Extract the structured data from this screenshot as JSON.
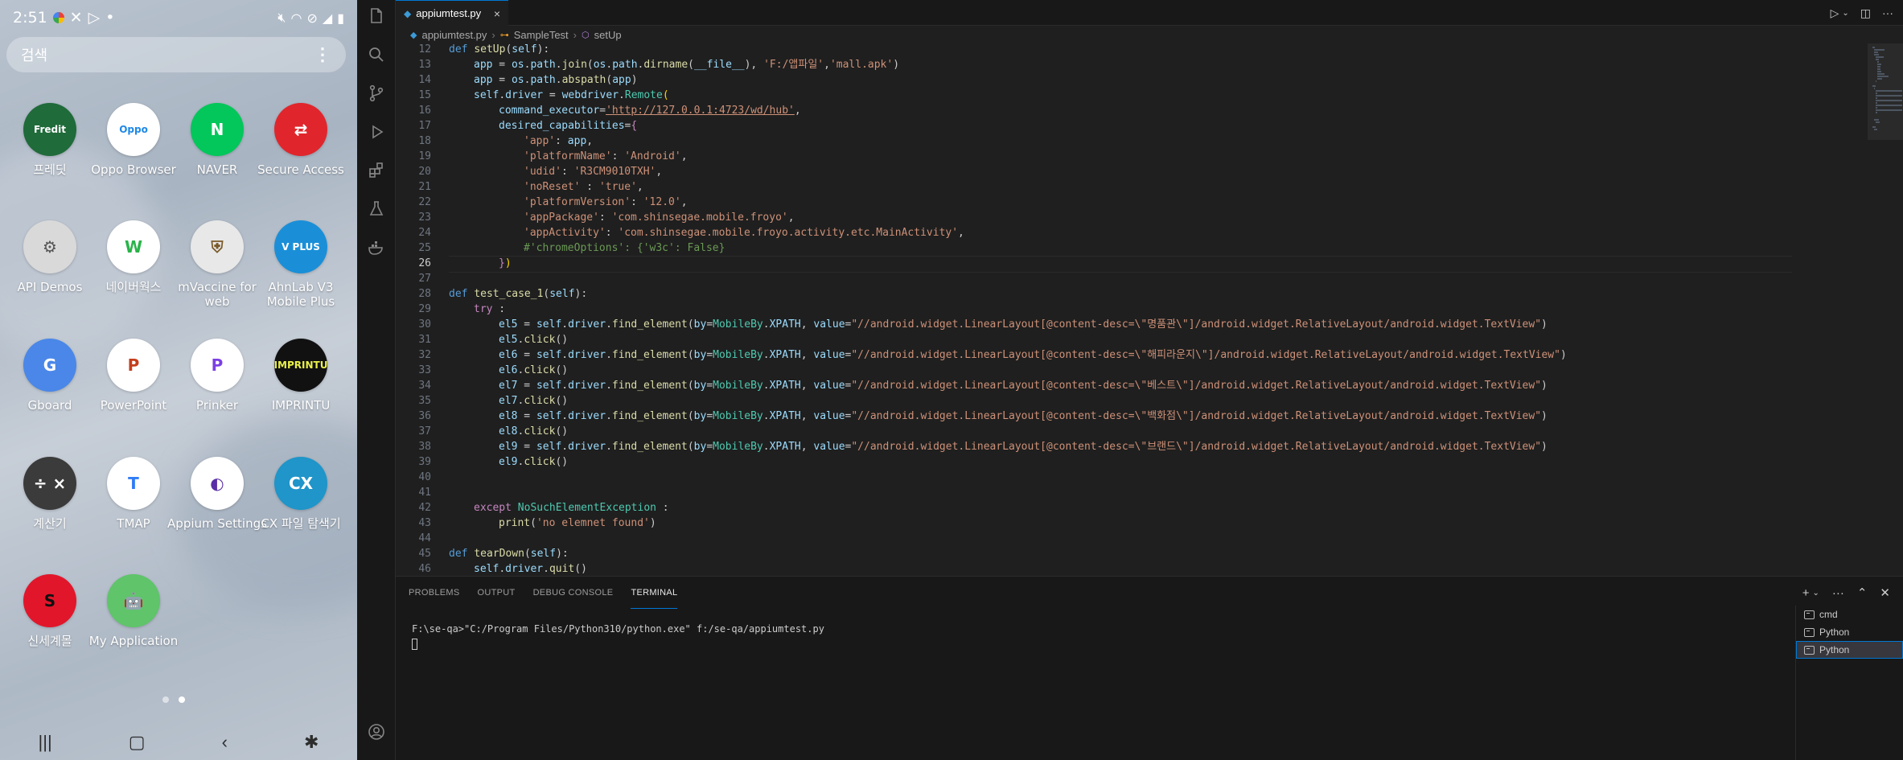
{
  "phone": {
    "status": {
      "time": "2:51",
      "left_indicator": "•"
    },
    "search": {
      "placeholder": "검색",
      "more_icon": "⋮"
    },
    "apps": [
      {
        "label": "프레딧",
        "glyph": "Fredit",
        "bg": "#1f6b3a",
        "fg": "#ffffff",
        "icon": "fredit-app-icon"
      },
      {
        "label": "Oppo Browser",
        "glyph": "Oppo",
        "bg": "#ffffff",
        "fg": "#1e88e5",
        "icon": "oppo-browser-app-icon"
      },
      {
        "label": "NAVER",
        "glyph": "N",
        "bg": "#03c75a",
        "fg": "#ffffff",
        "icon": "naver-app-icon"
      },
      {
        "label": "Secure Access",
        "glyph": "⇄",
        "bg": "#e0262c",
        "fg": "#ffffff",
        "icon": "secure-access-app-icon"
      },
      {
        "label": "API Demos",
        "glyph": "⚙",
        "bg": "#d9d9d9",
        "fg": "#555555",
        "icon": "api-demos-app-icon"
      },
      {
        "label": "네이버웍스",
        "glyph": "W",
        "bg": "#ffffff",
        "fg": "#2ab34a",
        "icon": "naver-works-app-icon"
      },
      {
        "label": "mVaccine for web",
        "glyph": "⛨",
        "bg": "#e8e8e8",
        "fg": "#7a5a2a",
        "icon": "mvaccine-app-icon"
      },
      {
        "label": "AhnLab V3 Mobile Plus",
        "glyph": "V PLUS",
        "bg": "#1a8fd8",
        "fg": "#ffffff",
        "icon": "ahnlab-v3-app-icon"
      },
      {
        "label": "Gboard",
        "glyph": "G",
        "bg": "#4a87e8",
        "fg": "#ffffff",
        "icon": "gboard-app-icon"
      },
      {
        "label": "PowerPoint",
        "glyph": "P",
        "bg": "#ffffff",
        "fg": "#c43e1c",
        "icon": "powerpoint-app-icon"
      },
      {
        "label": "Prinker",
        "glyph": "P",
        "bg": "#ffffff",
        "fg": "#7b3fe4",
        "icon": "prinker-app-icon"
      },
      {
        "label": "IMPRINTU",
        "glyph": "IMPRINTU",
        "bg": "#111111",
        "fg": "#e9f04a",
        "icon": "imprintu-app-icon"
      },
      {
        "label": "계산기",
        "glyph": "÷ ×",
        "bg": "#3b3b3b",
        "fg": "#ffffff",
        "icon": "calculator-app-icon"
      },
      {
        "label": "TMAP",
        "glyph": "T",
        "bg": "#ffffff",
        "fg": "#2f7cf6",
        "icon": "tmap-app-icon"
      },
      {
        "label": "Appium Settings",
        "glyph": "◐",
        "bg": "#ffffff",
        "fg": "#5a2ea6",
        "icon": "appium-settings-app-icon"
      },
      {
        "label": "CX 파일 탐색기",
        "glyph": "CX",
        "bg": "#1f95c9",
        "fg": "#ffffff",
        "icon": "cx-file-explorer-app-icon"
      },
      {
        "label": "신세계몰",
        "glyph": "S",
        "bg": "#e1162b",
        "fg": "#111111",
        "icon": "shinsegae-mall-app-icon"
      },
      {
        "label": "My Application",
        "glyph": "🤖",
        "bg": "#5fc46a",
        "fg": "#ffffff",
        "icon": "my-application-app-icon"
      }
    ],
    "nav": {
      "recents": "|||",
      "home": "▢",
      "back": "‹",
      "accessibility": "✱"
    }
  },
  "vscode": {
    "tab": {
      "filename": "appiumtest.py",
      "close": "×"
    },
    "breadcrumb": [
      "appiumtest.py",
      "SampleTest",
      "setUp"
    ],
    "code": [
      {
        "n": "12",
        "h": "<span class=\"kw\">def</span> <span class=\"fn\">setUp</span>(<span class=\"var\">self</span>):",
        "indent": 1
      },
      {
        "n": "13",
        "h": "<span class=\"var\">app</span> = <span class=\"var\">os</span>.<span class=\"var\">path</span>.<span class=\"fn\">join</span>(<span class=\"var\">os</span>.<span class=\"var\">path</span>.<span class=\"fn\">dirname</span>(<span class=\"var\">__file__</span>), <span class=\"str\">'F:/앱파일'</span>,<span class=\"str\">'mall.apk'</span>)",
        "indent": 2
      },
      {
        "n": "14",
        "h": "<span class=\"var\">app</span> = <span class=\"var\">os</span>.<span class=\"var\">path</span>.<span class=\"fn\">abspath</span>(<span class=\"var\">app</span>)",
        "indent": 2
      },
      {
        "n": "15",
        "h": "<span class=\"var\">self</span>.<span class=\"var\">driver</span> = <span class=\"var\">webdriver</span>.<span class=\"cls\">Remote</span><span class=\"brk\">(</span>",
        "indent": 2
      },
      {
        "n": "16",
        "h": "<span class=\"var\">command_executor</span>=<span class=\"url\">'http://127.0.0.1:4723/wd/hub'</span>,",
        "indent": 3
      },
      {
        "n": "17",
        "h": "<span class=\"var\">desired_capabilities</span>=<span class=\"kw2\">{</span>",
        "indent": 3
      },
      {
        "n": "18",
        "h": "<span class=\"str\">'app'</span>: <span class=\"var\">app</span>,",
        "indent": 4
      },
      {
        "n": "19",
        "h": "<span class=\"str\">'platformName'</span>: <span class=\"str\">'Android'</span>,",
        "indent": 4
      },
      {
        "n": "20",
        "h": "<span class=\"str\">'udid'</span>: <span class=\"str\">'R3CM9010TXH'</span>,",
        "indent": 4
      },
      {
        "n": "21",
        "h": "<span class=\"str\">'noReset'</span> : <span class=\"str\">'true'</span>,",
        "indent": 4
      },
      {
        "n": "22",
        "h": "<span class=\"str\">'platformVersion'</span>: <span class=\"str\">'12.0'</span>,",
        "indent": 4
      },
      {
        "n": "23",
        "h": "<span class=\"str\">'appPackage'</span>: <span class=\"str\">'com.shinsegae.mobile.froyo'</span>,",
        "indent": 4
      },
      {
        "n": "24",
        "h": "<span class=\"str\">'appActivity'</span>: <span class=\"str\">'com.shinsegae.mobile.froyo.activity.etc.MainActivity'</span>,",
        "indent": 4
      },
      {
        "n": "25",
        "h": "<span class=\"cmt\">#'chromeOptions': {'w3c': False}</span>",
        "indent": 4
      },
      {
        "n": "26",
        "h": "<span class=\"kw2\">}</span><span class=\"brk\">)</span>",
        "indent": 3,
        "current": true
      },
      {
        "n": "27",
        "h": "",
        "indent": 0
      },
      {
        "n": "28",
        "h": "<span class=\"kw\">def</span> <span class=\"fn\">test_case_1</span>(<span class=\"var\">self</span>):",
        "indent": 1
      },
      {
        "n": "29",
        "h": "<span class=\"kw2\">try</span> :",
        "indent": 2
      },
      {
        "n": "30",
        "h": "<span class=\"var\">el5</span> = <span class=\"var\">self</span>.<span class=\"var\">driver</span>.<span class=\"fn\">find_element</span>(<span class=\"var\">by</span>=<span class=\"cls\">MobileBy</span>.<span class=\"var\">XPATH</span>, <span class=\"var\">value</span>=<span class=\"str\">\"//android.widget.LinearLayout[@content-desc=\\\"명품관\\\"]/android.widget.RelativeLayout/android.widget.TextView\"</span>)",
        "indent": 3
      },
      {
        "n": "31",
        "h": "<span class=\"var\">el5</span>.<span class=\"fn\">click</span>()",
        "indent": 3
      },
      {
        "n": "32",
        "h": "<span class=\"var\">el6</span> = <span class=\"var\">self</span>.<span class=\"var\">driver</span>.<span class=\"fn\">find_element</span>(<span class=\"var\">by</span>=<span class=\"cls\">MobileBy</span>.<span class=\"var\">XPATH</span>, <span class=\"var\">value</span>=<span class=\"str\">\"//android.widget.LinearLayout[@content-desc=\\\"해피라운지\\\"]/android.widget.RelativeLayout/android.widget.TextView\"</span>)",
        "indent": 3
      },
      {
        "n": "33",
        "h": "<span class=\"var\">el6</span>.<span class=\"fn\">click</span>()",
        "indent": 3
      },
      {
        "n": "34",
        "h": "<span class=\"var\">el7</span> = <span class=\"var\">self</span>.<span class=\"var\">driver</span>.<span class=\"fn\">find_element</span>(<span class=\"var\">by</span>=<span class=\"cls\">MobileBy</span>.<span class=\"var\">XPATH</span>, <span class=\"var\">value</span>=<span class=\"str\">\"//android.widget.LinearLayout[@content-desc=\\\"베스트\\\"]/android.widget.RelativeLayout/android.widget.TextView\"</span>)",
        "indent": 3
      },
      {
        "n": "35",
        "h": "<span class=\"var\">el7</span>.<span class=\"fn\">click</span>()",
        "indent": 3
      },
      {
        "n": "36",
        "h": "<span class=\"var\">el8</span> = <span class=\"var\">self</span>.<span class=\"var\">driver</span>.<span class=\"fn\">find_element</span>(<span class=\"var\">by</span>=<span class=\"cls\">MobileBy</span>.<span class=\"var\">XPATH</span>, <span class=\"var\">value</span>=<span class=\"str\">\"//android.widget.LinearLayout[@content-desc=\\\"백화점\\\"]/android.widget.RelativeLayout/android.widget.TextView\"</span>)",
        "indent": 3
      },
      {
        "n": "37",
        "h": "<span class=\"var\">el8</span>.<span class=\"fn\">click</span>()",
        "indent": 3
      },
      {
        "n": "38",
        "h": "<span class=\"var\">el9</span> = <span class=\"var\">self</span>.<span class=\"var\">driver</span>.<span class=\"fn\">find_element</span>(<span class=\"var\">by</span>=<span class=\"cls\">MobileBy</span>.<span class=\"var\">XPATH</span>, <span class=\"var\">value</span>=<span class=\"str\">\"//android.widget.LinearLayout[@content-desc=\\\"브랜드\\\"]/android.widget.RelativeLayout/android.widget.TextView\"</span>)",
        "indent": 3
      },
      {
        "n": "39",
        "h": "<span class=\"var\">el9</span>.<span class=\"fn\">click</span>()",
        "indent": 3
      },
      {
        "n": "40",
        "h": "",
        "indent": 0
      },
      {
        "n": "41",
        "h": "",
        "indent": 0
      },
      {
        "n": "42",
        "h": "<span class=\"kw2\">except</span> <span class=\"cls\">NoSuchElementException</span> :",
        "indent": 2
      },
      {
        "n": "43",
        "h": "<span class=\"fn\">print</span>(<span class=\"str\">'no elemnet found'</span>)",
        "indent": 3
      },
      {
        "n": "44",
        "h": "",
        "indent": 0
      },
      {
        "n": "45",
        "h": "<span class=\"kw\">def</span> <span class=\"fn\">tearDown</span>(<span class=\"var\">self</span>):",
        "indent": 1
      },
      {
        "n": "46",
        "h": "<span class=\"var\">self</span>.<span class=\"var\">driver</span>.<span class=\"fn\">quit</span>()",
        "indent": 2
      }
    ],
    "panel": {
      "tabs": [
        "PROBLEMS",
        "OUTPUT",
        "DEBUG CONSOLE",
        "TERMINAL"
      ],
      "active_tab": "TERMINAL",
      "terminal_line": "F:\\se-qa>\"C:/Program Files/Python310/python.exe\" f:/se-qa/appiumtest.py",
      "terminals": [
        "cmd",
        "Python",
        "Python"
      ],
      "active_terminal": 2
    },
    "colors": {
      "accent": "#0078d4",
      "editor_bg": "#1f1f1f",
      "panel_bg": "#181818"
    }
  }
}
